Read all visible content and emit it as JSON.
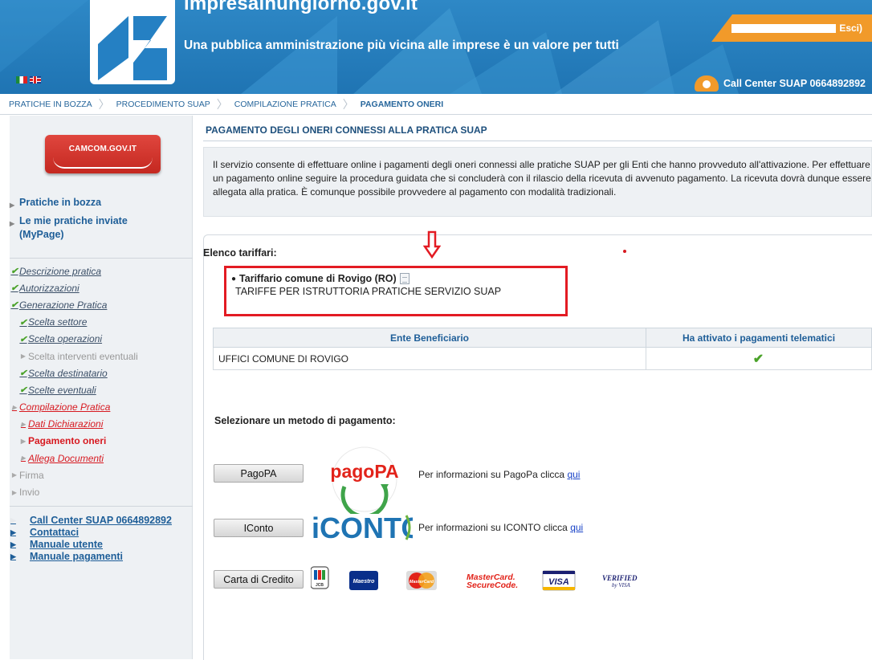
{
  "header": {
    "site_name": "impresainungiorno.gov.it",
    "tagline": "Una pubblica amministrazione più vicina alle imprese è un valore per tutti",
    "logout": "Esci)",
    "call_center": "Call Center SUAP 0664892892",
    "brand_color": "#2580c3",
    "accent_color": "#f19a2a"
  },
  "breadcrumb": [
    {
      "label": "PRATICHE IN BOZZA"
    },
    {
      "label": "PROCEDIMENTO SUAP"
    },
    {
      "label": "COMPILAZIONE PRATICA"
    },
    {
      "label": "PAGAMENTO ONERI"
    }
  ],
  "sidebar": {
    "camcom_label": "CAMCOM.GOV.IT",
    "links": [
      "Pratiche in bozza",
      "Le mie pratiche inviate (MyPage)"
    ],
    "steps": [
      {
        "label": "Descrizione pratica",
        "state": "done"
      },
      {
        "label": "Autorizzazioni",
        "state": "done"
      },
      {
        "label": "Generazione Pratica",
        "state": "done"
      },
      {
        "label": "Scelta settore",
        "state": "done"
      },
      {
        "label": "Scelta operazioni",
        "state": "done"
      },
      {
        "label": "Scelta interventi eventuali",
        "state": "pending"
      },
      {
        "label": "Scelta destinatario",
        "state": "done"
      },
      {
        "label": "Scelte eventuali",
        "state": "done"
      },
      {
        "label": "Compilazione Pratica",
        "state": "in-progress"
      },
      {
        "label": "Dati Dichiarazioni",
        "state": "in-progress"
      },
      {
        "label": "Pagamento oneri",
        "state": "current"
      },
      {
        "label": "Allega Documenti",
        "state": "in-progress"
      },
      {
        "label": "Firma",
        "state": "pending"
      },
      {
        "label": "Invio",
        "state": "pending"
      }
    ],
    "bottom_links": [
      "Call Center SUAP 0664892892",
      "Contattaci",
      "Manuale utente",
      "Manuale pagamenti"
    ]
  },
  "main": {
    "title": "PAGAMENTO DEGLI ONERI CONNESSI ALLA PRATICA SUAP",
    "intro": "Il servizio consente di effettuare online i pagamenti degli oneri connessi alle pratiche SUAP per gli Enti che hanno provveduto all'attivazione. Per effettuare un pagamento online seguire la procedura guidata che si concluderà con il rilascio della ricevuta di avvenuto pagamento. La ricevuta dovrà dunque essere allegata alla pratica. È comunque possibile provvedere al pagamento con modalità tradizionali.",
    "tariff_heading": "Elenco tariffari:",
    "tariff_name": "Tariffario comune di Rovigo (RO)",
    "tariff_desc": "TARIFFE PER ISTRUTTORIA PRATICHE SERVIZIO SUAP",
    "table": {
      "headers": [
        "Ente Beneficiario",
        "Ha attivato i pagamenti telematici"
      ],
      "rows": [
        {
          "ente": "UFFICI COMUNE DI ROVIGO",
          "active": true
        }
      ]
    },
    "payment_heading": "Selezionare un metodo di pagamento:",
    "methods": [
      {
        "button": "PagoPA",
        "logo_text": "pagoPA",
        "info": "Per informazioni su PagoPa clicca",
        "link": "qui"
      },
      {
        "button": "IConto",
        "logo_text": "iCONTO",
        "info": "Per informazioni su ICONTO clicca",
        "link": "qui"
      },
      {
        "button": "Carta di Credito"
      }
    ],
    "card_logos": {
      "jcb": "JCB",
      "maestro": "Maestro",
      "mastercard": "MasterCard",
      "mc_secure_1": "MasterCard.",
      "mc_secure_2": "SecureCode.",
      "visa": "VISA",
      "vbv_1": "VERIFIED",
      "vbv_2": "by VISA"
    }
  }
}
